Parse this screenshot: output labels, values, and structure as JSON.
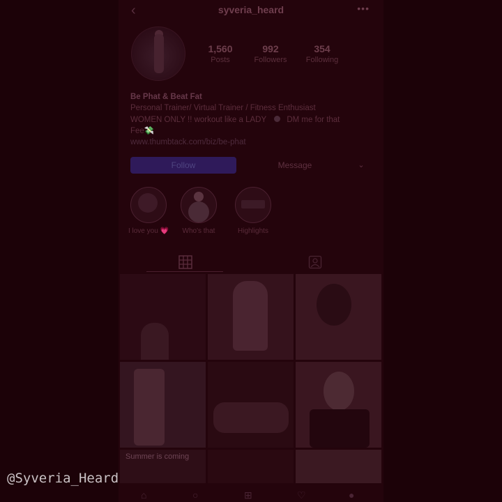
{
  "profile": {
    "username": "syveria_heard",
    "stats": [
      {
        "value": "1,560",
        "label": "Posts"
      },
      {
        "value": "992",
        "label": "Followers"
      },
      {
        "value": "354",
        "label": "Following"
      }
    ],
    "bio": {
      "name": "Be Phat & Beat Fat",
      "line1": "Personal Trainer/ Virtual Trainer / Fitness Enthusiast",
      "line2": "WOMEN ONLY !! workout like a LADY",
      "line2b": "DM me for that",
      "line3": "Fee💸",
      "link": "www.thumbtack.com/biz/be-phat"
    },
    "buttons": {
      "follow": "Follow",
      "message": "Message",
      "more": "⌄"
    }
  },
  "highlights": [
    {
      "label": "I love you 💗"
    },
    {
      "label": "Who's that"
    },
    {
      "label": "Highlights"
    }
  ],
  "tabs": {
    "grid_icon": "grid-icon",
    "tagged_icon": "tagged-icon"
  },
  "grid": {
    "caption": "Summer is coming"
  },
  "watermark": "@Syveria_Heard",
  "colors": {
    "overlay": "#24040c",
    "follow_button": "#2f1a5a"
  }
}
